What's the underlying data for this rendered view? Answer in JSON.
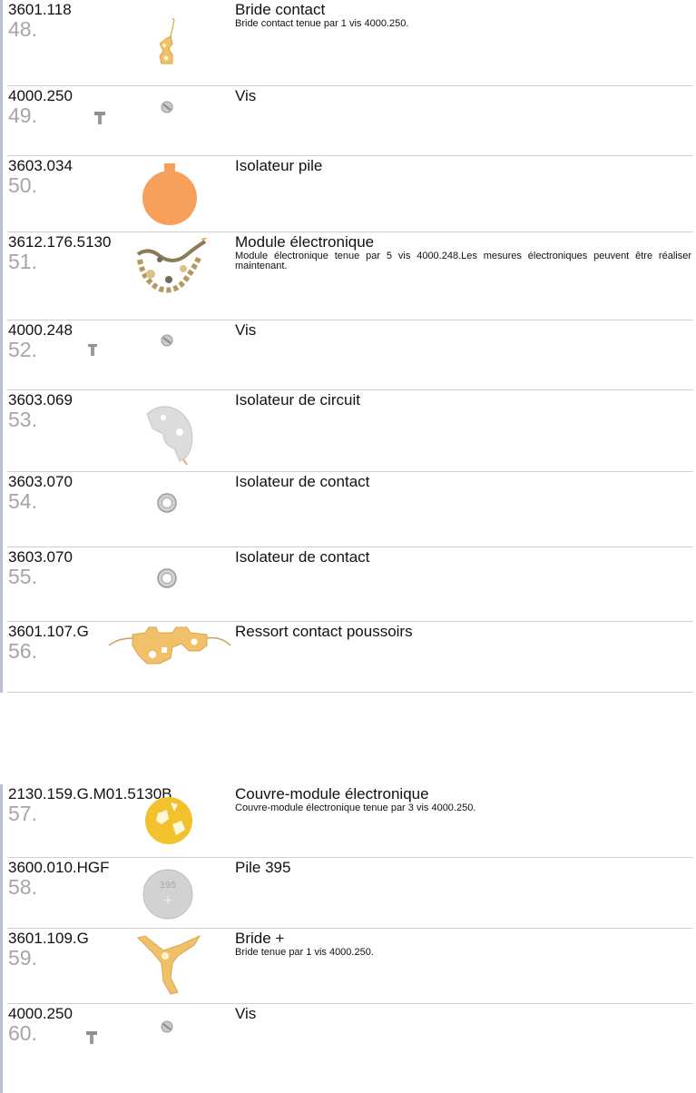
{
  "sections": [
    {
      "items": [
        {
          "ref": "3601.118",
          "num": "48.",
          "title": "Bride contact",
          "desc": "Bride contact tenue par 1 vis 4000.250.",
          "icon": "bride-contact-icon"
        },
        {
          "ref": "4000.250",
          "num": "49.",
          "title": "Vis",
          "desc": "",
          "icon": "screw-icon"
        },
        {
          "ref": "3603.034",
          "num": "50.",
          "title": "Isolateur pile",
          "desc": "",
          "icon": "battery-insulator-icon"
        },
        {
          "ref": "3612.176.5130",
          "num": "51.",
          "title": "Module électronique",
          "desc": "Module électronique tenue par 5 vis 4000.248.Les mesures électroniques peuvent être réaliser maintenant.",
          "icon": "electronic-module-icon"
        },
        {
          "ref": "4000.248",
          "num": "52.",
          "title": "Vis",
          "desc": "",
          "icon": "screw-icon"
        },
        {
          "ref": "3603.069",
          "num": "53.",
          "title": "Isolateur de circuit",
          "desc": "",
          "icon": "circuit-insulator-icon"
        },
        {
          "ref": "3603.070",
          "num": "54.",
          "title": "Isolateur de contact",
          "desc": "",
          "icon": "contact-insulator-icon"
        },
        {
          "ref": "3603.070",
          "num": "55.",
          "title": "Isolateur de contact",
          "desc": "",
          "icon": "contact-insulator-icon"
        },
        {
          "ref": "3601.107.G",
          "num": "56.",
          "title": "Ressort contact poussoirs",
          "desc": "",
          "icon": "contact-spring-icon"
        }
      ]
    },
    {
      "items": [
        {
          "ref": "2130.159.G.M01.5130B",
          "num": "57.",
          "title": "Couvre-module électronique",
          "desc": "Couvre-module électronique tenue par 3 vis 4000.250.",
          "icon": "module-cover-icon"
        },
        {
          "ref": "3600.010.HGF",
          "num": "58.",
          "title": "Pile 395",
          "desc": "",
          "icon": "battery-icon",
          "battery_marking": "395"
        },
        {
          "ref": "3601.109.G",
          "num": "59.",
          "title": "Bride +",
          "desc": "Bride tenue par 1 vis 4000.250.",
          "icon": "bride-plus-icon"
        },
        {
          "ref": "4000.250",
          "num": "60.",
          "title": "Vis",
          "desc": "",
          "icon": "screw-icon"
        }
      ]
    }
  ],
  "colors": {
    "gold": "#f1c16a",
    "orange": "#f6a05c",
    "silver": "#c9c9c9",
    "rail": "#b9bfd6",
    "divider": "#cfd0d6",
    "number_gray": "#a6a6a6"
  }
}
